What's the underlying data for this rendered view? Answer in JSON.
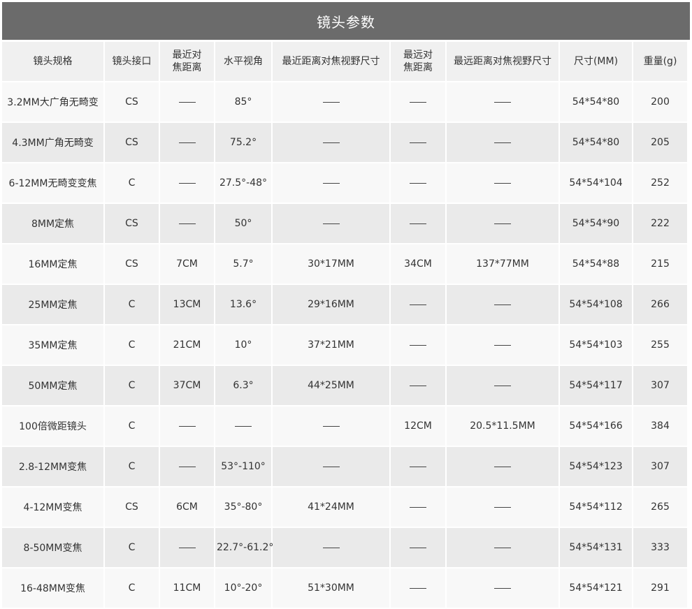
{
  "title": "镜头参数",
  "dash": "——",
  "columns": [
    "镜头规格",
    "镜头接口",
    "最近对焦距离",
    "水平视角",
    "最近距离对焦视野尺寸",
    "最远对焦距离",
    "最远距离对焦视野尺寸",
    "尺寸(MM)",
    "重量(g)"
  ],
  "rows": [
    [
      "3.2MM大广角无畸变",
      "CS",
      "——",
      "85°",
      "——",
      "——",
      "——",
      "54*54*80",
      "200"
    ],
    [
      "4.3MM广角无畸变",
      "CS",
      "——",
      "75.2°",
      "——",
      "——",
      "——",
      "54*54*80",
      "205"
    ],
    [
      "6-12MM无畸变变焦",
      "C",
      "——",
      "27.5°-48°",
      "——",
      "——",
      "——",
      "54*54*104",
      "252"
    ],
    [
      "8MM定焦",
      "CS",
      "——",
      "50°",
      "——",
      "——",
      "——",
      "54*54*90",
      "222"
    ],
    [
      "16MM定焦",
      "CS",
      "7CM",
      "5.7°",
      "30*17MM",
      "34CM",
      "137*77MM",
      "54*54*88",
      "215"
    ],
    [
      "25MM定焦",
      "C",
      "13CM",
      "13.6°",
      "29*16MM",
      "——",
      "——",
      "54*54*108",
      "266"
    ],
    [
      "35MM定焦",
      "C",
      "21CM",
      "10°",
      "37*21MM",
      "——",
      "——",
      "54*54*103",
      "255"
    ],
    [
      "50MM定焦",
      "C",
      "37CM",
      "6.3°",
      "44*25MM",
      "——",
      "——",
      "54*54*117",
      "307"
    ],
    [
      "100倍微距镜头",
      "C",
      "——",
      "——",
      "——",
      "12CM",
      "20.5*11.5MM",
      "54*54*166",
      "384"
    ],
    [
      "2.8-12MM变焦",
      "C",
      "——",
      "53°-110°",
      "——",
      "——",
      "——",
      "54*54*123",
      "307"
    ],
    [
      "4-12MM变焦",
      "CS",
      "6CM",
      "35°-80°",
      "41*24MM",
      "——",
      "——",
      "54*54*112",
      "265"
    ],
    [
      "8-50MM变焦",
      "C",
      "——",
      "22.7°-61.2°",
      "——",
      "——",
      "——",
      "54*54*131",
      "333"
    ],
    [
      "16-48MM变焦",
      "C",
      "11CM",
      "10°-20°",
      "51*30MM",
      "——",
      "——",
      "54*54*121",
      "291"
    ]
  ]
}
